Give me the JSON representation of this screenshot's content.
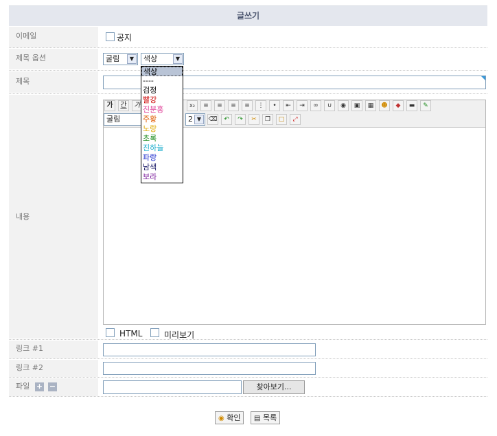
{
  "header": {
    "title": "글쓰기"
  },
  "labels": {
    "email": "이메일",
    "title_option": "제목 옵션",
    "subject": "제목",
    "content": "내용",
    "link1": "링크 #1",
    "link2": "링크 #2",
    "file": "파일"
  },
  "notice_label": "공지",
  "title_option": {
    "font_value": "굴림",
    "color_value": "색상"
  },
  "color_dropdown": [
    {
      "label": "색상",
      "color": "#000000"
    },
    {
      "label": "----",
      "color": "#000000"
    },
    {
      "label": "검정",
      "color": "#000000"
    },
    {
      "label": "빨강",
      "color": "#cc0000"
    },
    {
      "label": "진분홍",
      "color": "#e0449a"
    },
    {
      "label": "주황",
      "color": "#e05a00"
    },
    {
      "label": "노랑",
      "color": "#e0a800"
    },
    {
      "label": "초록",
      "color": "#1a8a1a"
    },
    {
      "label": "진하늘",
      "color": "#1aaccc"
    },
    {
      "label": "파랑",
      "color": "#1a2acc"
    },
    {
      "label": "남색",
      "color": "#1a1a66"
    },
    {
      "label": "보라",
      "color": "#7a1a9a"
    }
  ],
  "editor": {
    "font_value": "굴림",
    "size_value": "2",
    "bold_label": "가",
    "underline_label": "간",
    "italic_label": "가"
  },
  "options": {
    "html_label": "HTML",
    "preview_label": "미리보기"
  },
  "file": {
    "browse_label": "찾아보기..."
  },
  "actions": {
    "confirm_label": "확인",
    "list_label": "목록"
  }
}
